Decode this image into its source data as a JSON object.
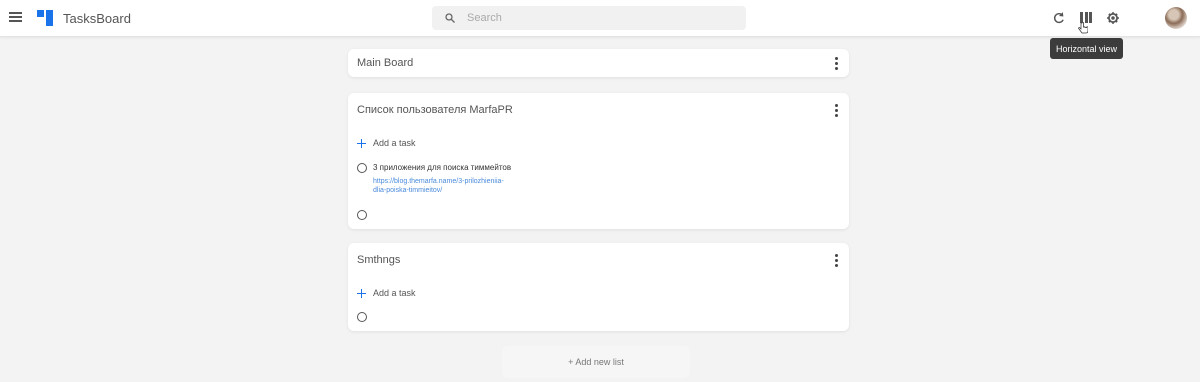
{
  "app": {
    "title": "TasksBoard",
    "search_placeholder": "Search",
    "tooltip": "Horizontal view",
    "icons": [
      "menu-icon",
      "logo-icon",
      "search-icon",
      "refresh-icon",
      "horizontal-view-icon",
      "settings-icon",
      "avatar"
    ]
  },
  "boards": [
    {
      "title": "Main Board"
    },
    {
      "title": "Список пользователя MarfaPR",
      "add_task_label": "Add a task",
      "tasks": [
        {
          "title": "3 приложения для поиска тиммейтов",
          "link": "https://blog.themarfa.name/3-prilozhieniia-dlia-poiska-timmieitov/"
        },
        {
          "title": ""
        }
      ]
    },
    {
      "title": "Smthngs",
      "add_task_label": "Add a task",
      "tasks": [
        {
          "title": ""
        }
      ]
    }
  ],
  "add_list_label": "+ Add new list",
  "colors": {
    "accent": "#1a73e8",
    "background": "#f3f3f3",
    "link": "#4a8bdc"
  }
}
